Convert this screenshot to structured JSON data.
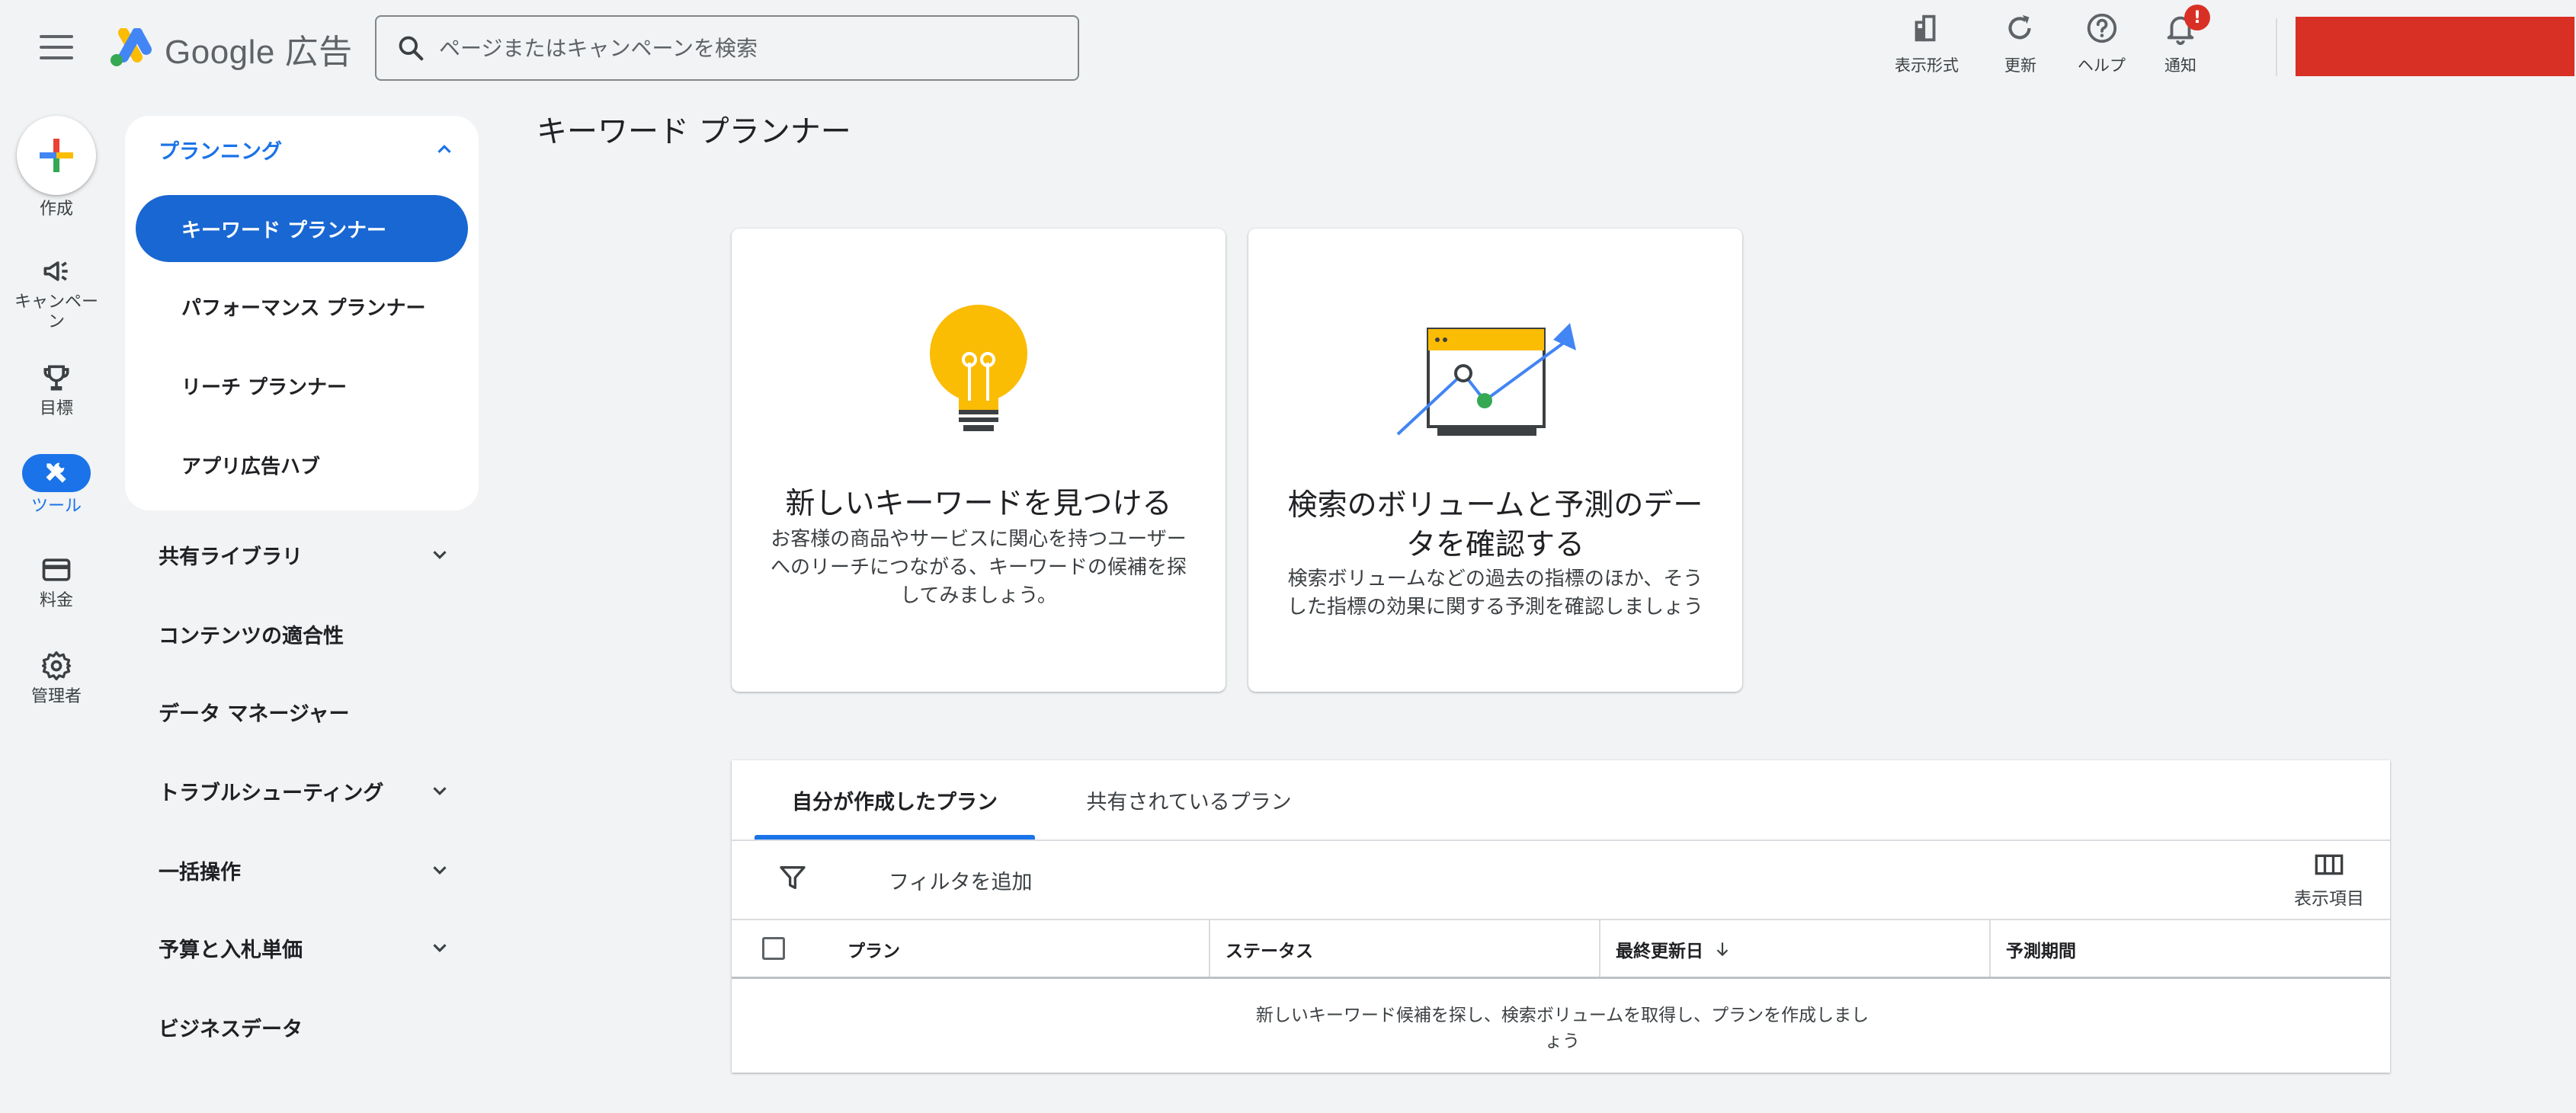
{
  "header": {
    "logo_text": "Google 広告",
    "search_placeholder": "ページまたはキャンペーンを検索",
    "buttons": {
      "view": "表示形式",
      "refresh": "更新",
      "help": "ヘルプ",
      "notifications": "通知",
      "notification_badge": "!"
    }
  },
  "rail": {
    "create": "作成",
    "campaigns": "キャンペーン",
    "goals": "目標",
    "tools": "ツール",
    "billing": "料金",
    "admin": "管理者"
  },
  "sidenav": {
    "planning": {
      "title": "プランニング",
      "items": [
        "キーワード プランナー",
        "パフォーマンス プランナー",
        "リーチ プランナー",
        "アプリ広告ハブ"
      ]
    },
    "sections": [
      "共有ライブラリ",
      "コンテンツの適合性",
      "データ マネージャー",
      "トラブルシューティング",
      "一括操作",
      "予算と入札単価",
      "ビジネスデータ"
    ]
  },
  "main": {
    "page_title": "キーワード プランナー",
    "cards": [
      {
        "title": "新しいキーワードを見つける",
        "desc": "お客様の商品やサービスに関心を持つユーザーへのリーチにつながる、キーワードの候補を探してみましょう。"
      },
      {
        "title": "検索のボリュームと予測のデータを確認する",
        "desc": "検索ボリュームなどの過去の指標のほか、そうした指標の効果に関する予測を確認しましょう"
      }
    ],
    "plans": {
      "tabs": [
        "自分が作成したプラン",
        "共有されているプラン"
      ],
      "filter_label": "フィルタを追加",
      "columns_label": "表示項目",
      "table_headers": [
        "プラン",
        "ステータス",
        "最終更新日",
        "予測期間"
      ],
      "empty_message": "新しいキーワード候補を探し、検索ボリュームを取得し、プランを作成しましょう"
    }
  },
  "colors": {
    "accent": "#1a73e8",
    "active_nav": "#1967d2",
    "badge": "#d93025",
    "account_block": "#d93025",
    "background": "#f1f3f4"
  }
}
